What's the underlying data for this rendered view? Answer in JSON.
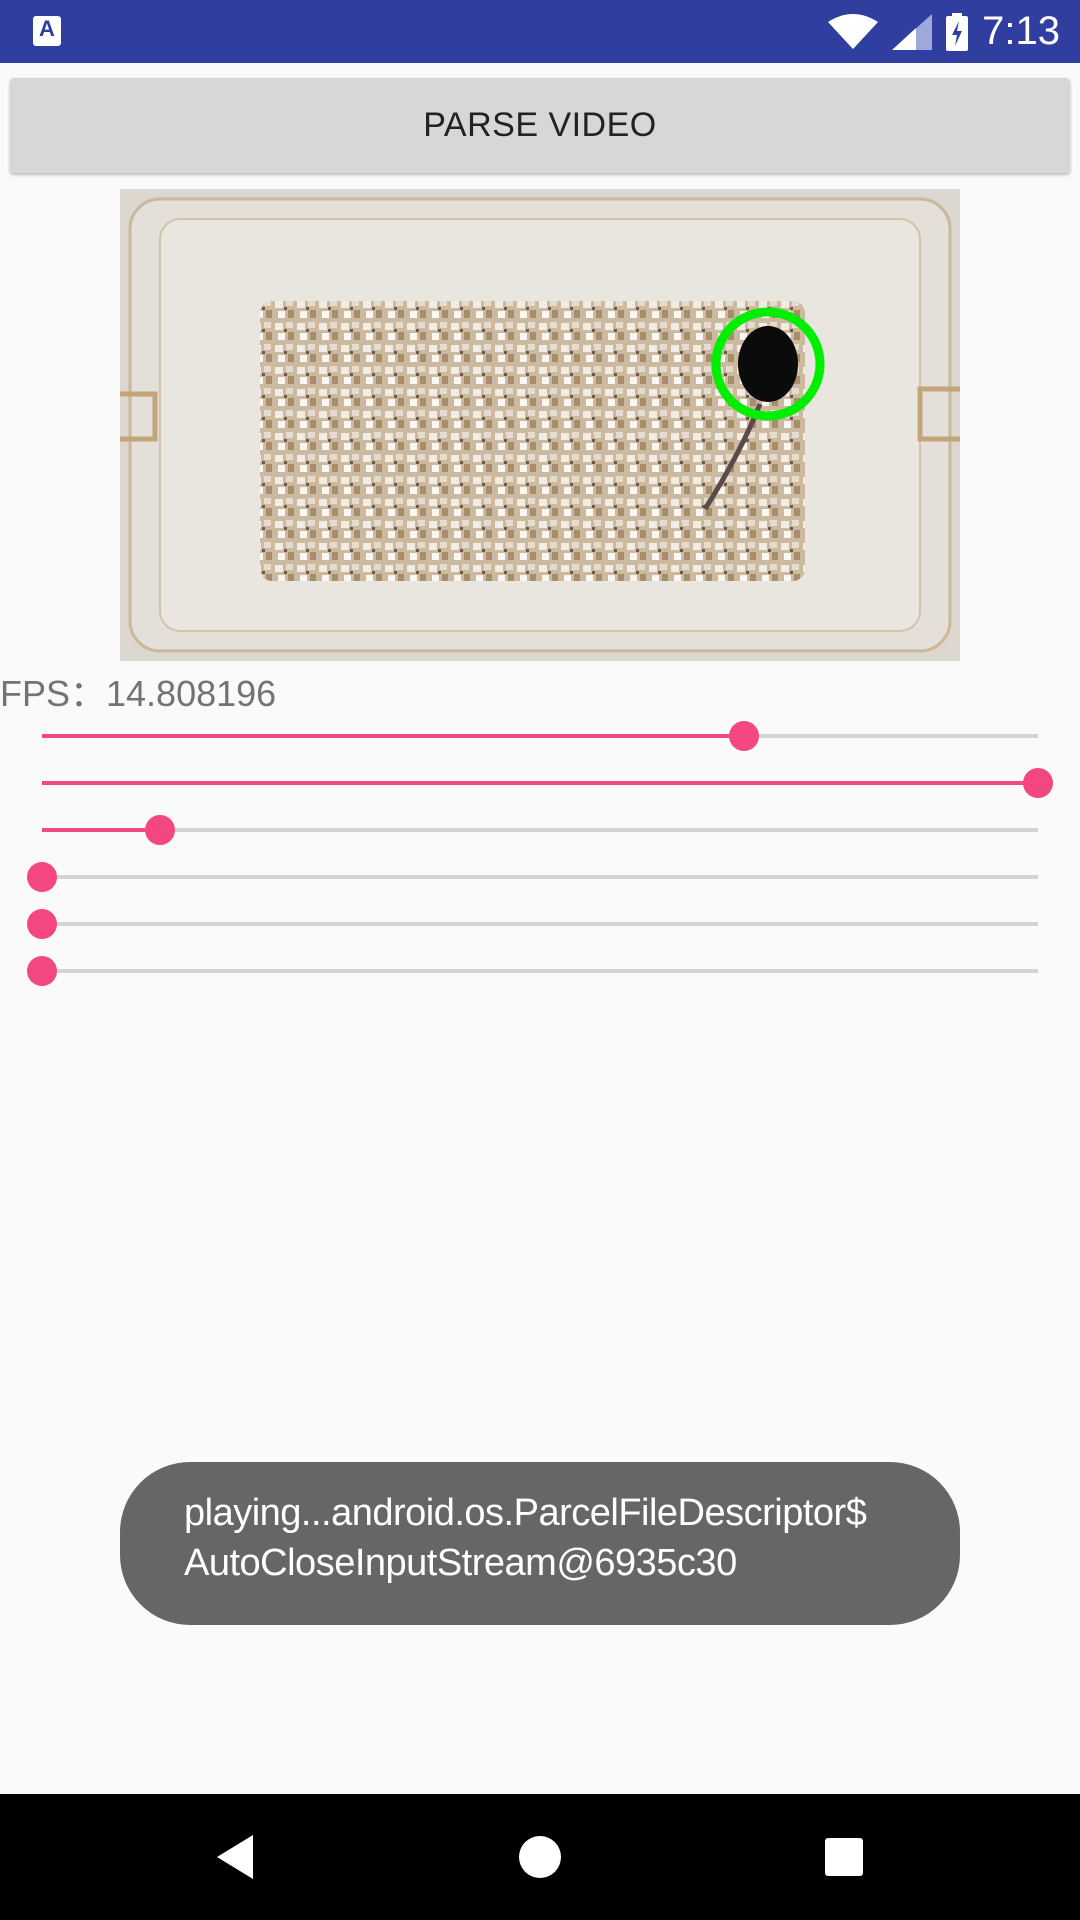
{
  "status_bar": {
    "app_icon_label": "A",
    "time": "7:13",
    "bar_color": "#303f9f",
    "icons": [
      "wifi-icon",
      "cell-signal-icon",
      "battery-charging-icon"
    ]
  },
  "toolbar": {
    "parse_video_label": "PARSE VIDEO"
  },
  "fps": {
    "label": "FPS：",
    "value": "14.808196"
  },
  "sliders": [
    {
      "name": "slider-1",
      "value": 0.705
    },
    {
      "name": "slider-2",
      "value": 1.0
    },
    {
      "name": "slider-3",
      "value": 0.118
    },
    {
      "name": "slider-4",
      "value": 0.0
    },
    {
      "name": "slider-5",
      "value": 0.0
    },
    {
      "name": "slider-6",
      "value": 0.0
    }
  ],
  "accent_color": "#f2487f",
  "toast": {
    "line1": "playing...android.os.ParcelFileDescriptor$",
    "line2": "AutoCloseInputStream@6935c30"
  },
  "nav_bar": {
    "icons": [
      "back-icon",
      "home-icon",
      "recents-icon"
    ]
  }
}
